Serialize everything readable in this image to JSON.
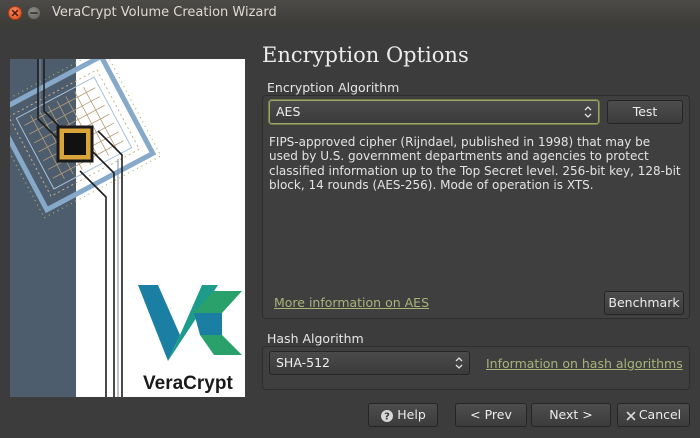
{
  "window": {
    "title": "VeraCrypt Volume Creation Wizard"
  },
  "page": {
    "heading": "Encryption Options"
  },
  "encryption": {
    "group_label": "Encryption Algorithm",
    "selected": "AES",
    "test_label": "Test",
    "description": "FIPS-approved cipher (Rijndael, published in 1998) that may be used by U.S. government departments and agencies to protect classified information up to the Top Secret level. 256-bit key, 128-bit block, 14 rounds (AES-256). Mode of operation is XTS.",
    "more_info_link": "More information on AES",
    "benchmark_label": "Benchmark"
  },
  "hash": {
    "group_label": "Hash Algorithm",
    "selected": "SHA-512",
    "info_link": "Information on hash algorithms"
  },
  "logo": {
    "text": "VeraCrypt"
  },
  "footer": {
    "help_label": "Help",
    "prev_label": "< Prev",
    "next_label": "Next >",
    "cancel_label": "Cancel"
  },
  "colors": {
    "accent_link": "#a8b47a",
    "logo_teal": "#1b7fa3",
    "logo_green": "#2aa16a",
    "chip_gold": "#d9a43a"
  }
}
